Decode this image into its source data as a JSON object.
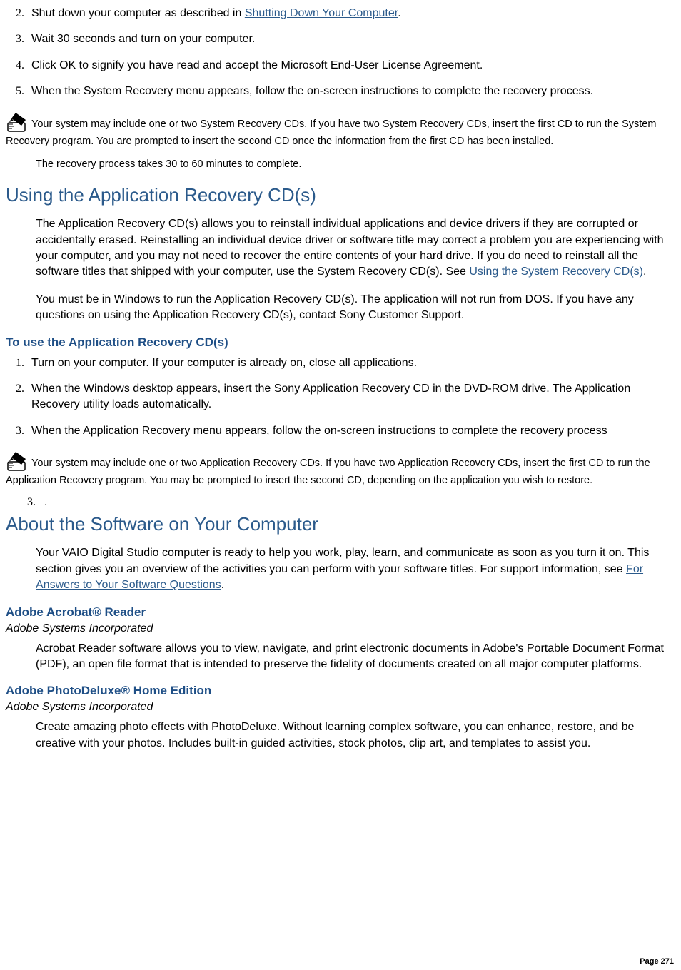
{
  "list1": {
    "start": 2,
    "items": [
      {
        "pre": "Shut down your computer as described in ",
        "link": "Shutting Down Your Computer",
        "post": "."
      },
      {
        "text": "Wait 30 seconds and turn on your computer."
      },
      {
        "text": "Click OK to signify you have read and accept the Microsoft End-User License Agreement."
      },
      {
        "text": "When the System Recovery menu appears, follow the on-screen instructions to complete the recovery process."
      }
    ]
  },
  "note1": "Your system may include one or two System Recovery CDs. If you have two System Recovery CDs, insert the first CD to run the System Recovery program. You are prompted to insert the second CD once the information from the first CD has been installed.",
  "note1_followup": "The recovery process takes 30 to 60 minutes to complete.",
  "section1": {
    "title": "Using the Application Recovery CD(s)",
    "p1_pre": "The Application Recovery CD(s) allows you to reinstall individual applications and device drivers if they are corrupted or accidentally erased. Reinstalling an individual device driver or software title may correct a problem you are experiencing with your computer, and you may not need to recover the entire contents of your hard drive. If you do need to reinstall all the software titles that shipped with your computer, use the System Recovery CD(s). See ",
    "p1_link": "Using the System Recovery CD(s)",
    "p1_post": ".",
    "p2": "You must be in Windows to run the Application Recovery CD(s). The application will not run from DOS. If you have any questions on using the Application Recovery CD(s), contact Sony Customer Support.",
    "subhead": "To use the Application Recovery CD(s)",
    "list": {
      "start": 1,
      "items": [
        "Turn on your computer. If your computer is already on, close all applications.",
        "When the Windows desktop appears, insert the Sony Application Recovery CD in the DVD-ROM drive. The Application Recovery utility loads automatically.",
        "When the Application Recovery menu appears, follow the on-screen instructions to complete the recovery process"
      ]
    }
  },
  "note2": "Your system may include one or two Application Recovery CDs. If you have two Application Recovery CDs, insert the first CD to run the Application Recovery program. You may be prompted to insert the second CD, depending on the application you wish to restore.",
  "orphan_num": "3.",
  "orphan_dot": ".",
  "section2": {
    "title": "About the Software on Your Computer",
    "p1_pre": "Your VAIO Digital Studio computer is ready to help you work, play, learn, and communicate as soon as you turn it on. This section gives you an overview of the activities you can perform with your software titles. For support information, see ",
    "p1_link": "For Answers to Your Software Questions",
    "p1_post": "."
  },
  "software": [
    {
      "title": "Adobe Acrobat® Reader",
      "vendor": "Adobe Systems Incorporated",
      "desc": "Acrobat Reader software allows you to view, navigate, and print electronic documents in Adobe's Portable Document Format (PDF), an open file format that is intended to preserve the fidelity of documents created on all major computer platforms."
    },
    {
      "title": "Adobe PhotoDeluxe® Home Edition",
      "vendor": "Adobe Systems Incorporated",
      "desc": "Create amazing photo effects with PhotoDeluxe. Without learning complex software, you can enhance, restore, and be creative with your photos. Includes built-in guided activities, stock photos, clip art, and templates to assist you."
    }
  ],
  "page_number": "Page 271"
}
